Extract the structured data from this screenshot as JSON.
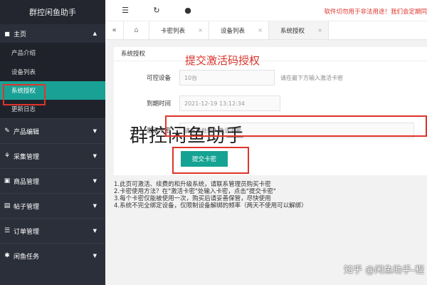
{
  "sidebar": {
    "app_title": "群控闲鱼助手",
    "home_group": {
      "label": "主页",
      "icon": "home-icon"
    },
    "home_items": [
      "产品介绍",
      "设备列表",
      "系统授权",
      "更新日志"
    ],
    "sections": [
      {
        "label": "产品编辑",
        "icon": "edit-icon"
      },
      {
        "label": "采集管理",
        "icon": "collect-icon"
      },
      {
        "label": "商品管理",
        "icon": "goods-icon"
      },
      {
        "label": "帖子管理",
        "icon": "post-icon"
      },
      {
        "label": "订单管理",
        "icon": "order-icon"
      },
      {
        "label": "闲鱼任务",
        "icon": "task-icon"
      }
    ]
  },
  "topbar": {
    "menu_icon": "menu-icon",
    "refresh_icon": "refresh-icon",
    "chat_icon": "chat-icon",
    "warning": "软件切勿用于非法用途！我们会定期同"
  },
  "tabs": {
    "items": [
      {
        "label": "卡密列表",
        "active": false
      },
      {
        "label": "设备列表",
        "active": false
      },
      {
        "label": "系统授权",
        "active": true
      }
    ]
  },
  "panel": {
    "title": "系统授权",
    "annotation": "提交激活码授权",
    "fields": {
      "devices_label": "可控设备",
      "devices_value": "10台",
      "devices_hint": "请在最下方输入激活卡密",
      "expire_label": "到期时间",
      "expire_value": "2021-12-19 13:12:34",
      "card_label": "激活卡密",
      "card_placeholder": "请在此处输入激活卡密"
    },
    "submit_label": "提交卡密",
    "watermark": "群控闲鱼助手"
  },
  "notes": [
    "1.此页可激活、续费的和升级系统，请联系管理员购买卡密",
    "2.卡密使用方法？在\"激活卡密\"处输入卡密，点击\"提交卡密\"",
    "3.每个卡密仅能被使用一次，购买后请妥善保管，尽快使用",
    "4.系统不完全绑定设备，仅限制设备解绑的频率（两天不使用可以解绑）"
  ],
  "footer_watermark": "知乎 @闲鱼助手-程",
  "colors": {
    "accent": "#16a393",
    "sidebar": "#2b2f3a",
    "warning": "#e0342b"
  }
}
